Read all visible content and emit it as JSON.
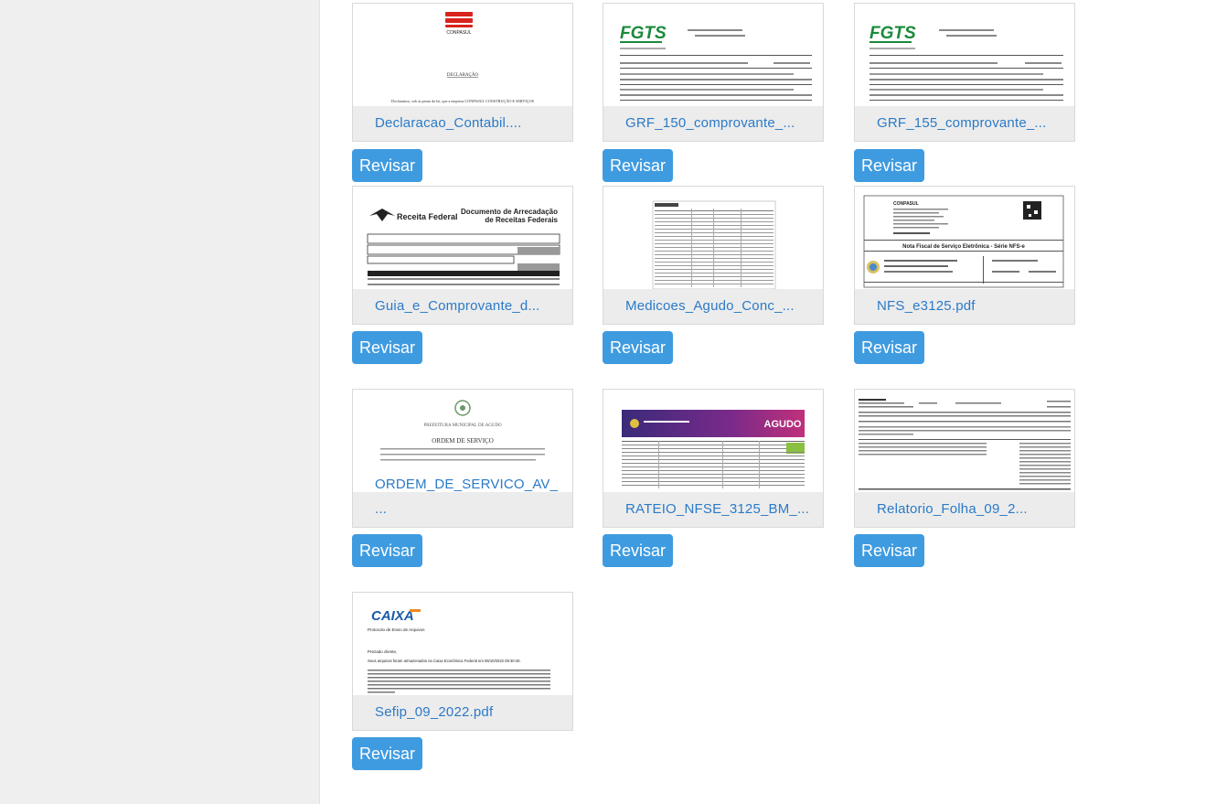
{
  "files": [
    {
      "name": "Declaracao_Contabil....",
      "button": "Revisar",
      "thumb_logo": "CONPASUL",
      "thumb_heading": "DECLARAÇÃO",
      "thumb_line": "Declaramos, sob as penas da lei, que a empresa CONPASUL CONSTRUÇÃO E SERVIÇOS"
    },
    {
      "name": "GRF_150_comprovante_...",
      "button": "Revisar",
      "thumb_logo": "FGTS"
    },
    {
      "name": "GRF_155_comprovante_...",
      "button": "Revisar",
      "thumb_logo": "FGTS"
    },
    {
      "name": "Guia_e_Comprovante_d...",
      "button": "Revisar",
      "thumb_logo": "Receita Federal",
      "thumb_title_1": "Documento de Arrecadação",
      "thumb_title_2": "de Receitas Federais"
    },
    {
      "name": "Medicoes_Agudo_Conc_...",
      "button": "Revisar"
    },
    {
      "name": "NFS_e3125.pdf",
      "button": "Revisar",
      "thumb_title": "Nota Fiscal de Serviço Eletrônica - Série NFS-e",
      "thumb_org": "CONPASUL"
    },
    {
      "name": "ORDEM_DE_SERVICO_AV_...",
      "button": "Revisar",
      "thumb_title": "ORDEM DE SERVIÇO",
      "thumb_org": "PREFEITURA MUNICIPAL DE AGUDO"
    },
    {
      "name": "RATEIO_NFSE_3125_BM_...",
      "button": "Revisar",
      "thumb_logo": "AGUDO"
    },
    {
      "name": "Relatorio_Folha_09_2...",
      "button": "Revisar"
    },
    {
      "name": "Sefip_09_2022.pdf",
      "button": "Revisar",
      "thumb_logo": "CAIXA",
      "thumb_sub": "Protocolo de Envio de Arquivos",
      "thumb_greeting": "Prezado cliente,",
      "thumb_line": "Seus arquivos foram armazenados na Caixa Econômica Federal em 06/10/2022 09:30:40."
    }
  ],
  "colors": {
    "accent": "#3f9be0",
    "link": "#2a7ac8",
    "sidebar": "#efefef",
    "card": "#ececec"
  },
  "icons": {
    "fgts_logo": "fgts-logo-icon",
    "caixa_logo": "caixa-logo-icon"
  }
}
